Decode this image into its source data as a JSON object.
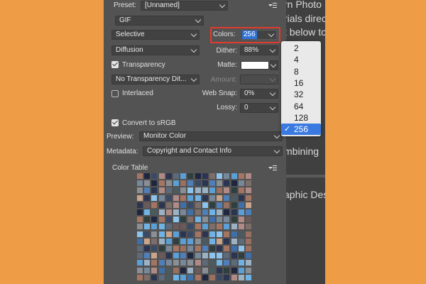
{
  "background_page": {
    "lines": [
      "rn Photo",
      "rials direc",
      "t below to",
      "mbining",
      "aphic Des"
    ]
  },
  "panel": {
    "preset_label": "Preset:",
    "preset_value": "[Unnamed]",
    "format_value": "GIF",
    "reduction_value": "Selective",
    "colors_label": "Colors:",
    "colors_value": "256",
    "dither_method": "Diffusion",
    "dither_label": "Dither:",
    "dither_value": "88%",
    "transparency_label": "Transparency",
    "transparency_checked": true,
    "matte_label": "Matte:",
    "matte_color": "#ffffff",
    "transparency_dither_value": "No Transparency Dit...",
    "amount_label": "Amount:",
    "interlaced_label": "Interlaced",
    "interlaced_checked": false,
    "websnap_label": "Web Snap:",
    "websnap_value": "0%",
    "lossy_label": "Lossy:",
    "lossy_value": "0",
    "convert_label": "Convert to sRGB",
    "convert_checked": true,
    "preview_label": "Preview:",
    "preview_value": "Monitor Color",
    "metadata_label": "Metadata:",
    "metadata_value": "Copyright and Contact Info",
    "color_table_label": "Color Table"
  },
  "colors_dropdown": {
    "options": [
      "2",
      "4",
      "8",
      "16",
      "32",
      "64",
      "128",
      "256"
    ],
    "selected": "256",
    "check_glyph": "✓"
  },
  "colors": {
    "background": "#ee9c45",
    "panel": "#535353",
    "highlight_box": "#e23b2e",
    "selection_blue": "#3a7ae0"
  },
  "color_table": {
    "palette": [
      "#6fb3e6",
      "#5a9fd6",
      "#3a4a66",
      "#8a8f96",
      "#b08a86",
      "#7e6e6a",
      "#4a5a5e",
      "#9ab2c4",
      "#2b3552",
      "#a57563",
      "#5c6a7a",
      "#1f2640",
      "#c9a48a",
      "#77889a",
      "#3f6fa8",
      "#8cc4ee",
      "#6a5a5a",
      "#2f3f3f",
      "#9a7060",
      "#4f7fb8"
    ]
  }
}
